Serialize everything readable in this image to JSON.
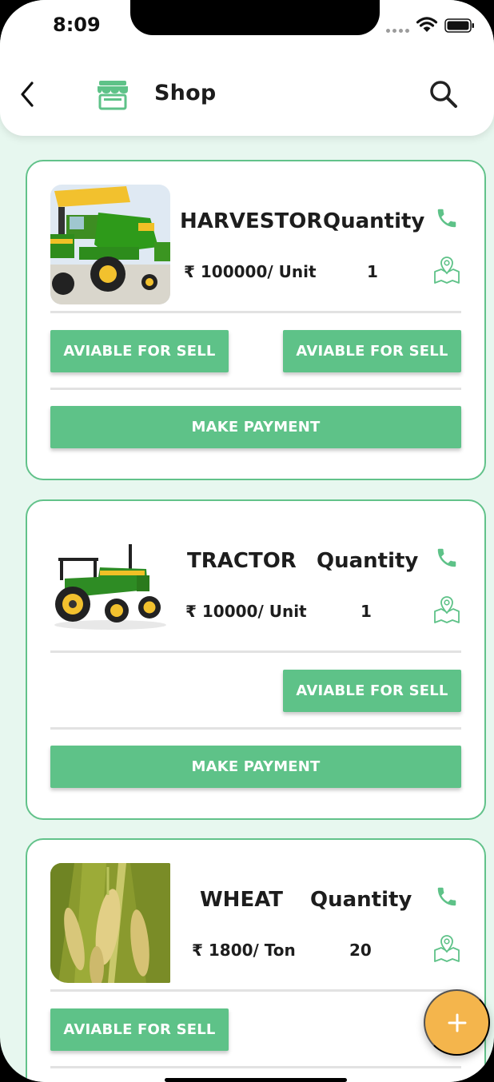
{
  "status_bar": {
    "time": "8:09"
  },
  "header": {
    "title": "Shop",
    "back_icon": "chevron-left-icon",
    "shop_icon": "storefront-icon",
    "search_icon": "search-icon"
  },
  "theme": {
    "accent": "#5ec288",
    "card_border": "#62c28a",
    "background": "#e7f7ef",
    "fab": "#f4b54c"
  },
  "products": [
    {
      "name": "HARVESTOR",
      "quantity_label": "Quantity",
      "price": "₹ 100000/ Unit",
      "quantity": "1",
      "image": "combine-harvester-photo",
      "buttons": [
        "AVIABLE FOR SELL",
        "AVIABLE FOR SELL"
      ],
      "payment_label": "MAKE PAYMENT"
    },
    {
      "name": "TRACTOR",
      "quantity_label": "Quantity",
      "price": "₹ 10000/ Unit",
      "quantity": "1",
      "image": "tractor-photo",
      "buttons": [
        "AVIABLE FOR SELL"
      ],
      "payment_label": "MAKE PAYMENT"
    },
    {
      "name": "WHEAT",
      "quantity_label": "Quantity",
      "price": "₹ 1800/ Ton",
      "quantity": "20",
      "image": "wheat-photo",
      "buttons": [
        "AVIABLE FOR SELL"
      ]
    }
  ],
  "fab": {
    "label": "+"
  }
}
